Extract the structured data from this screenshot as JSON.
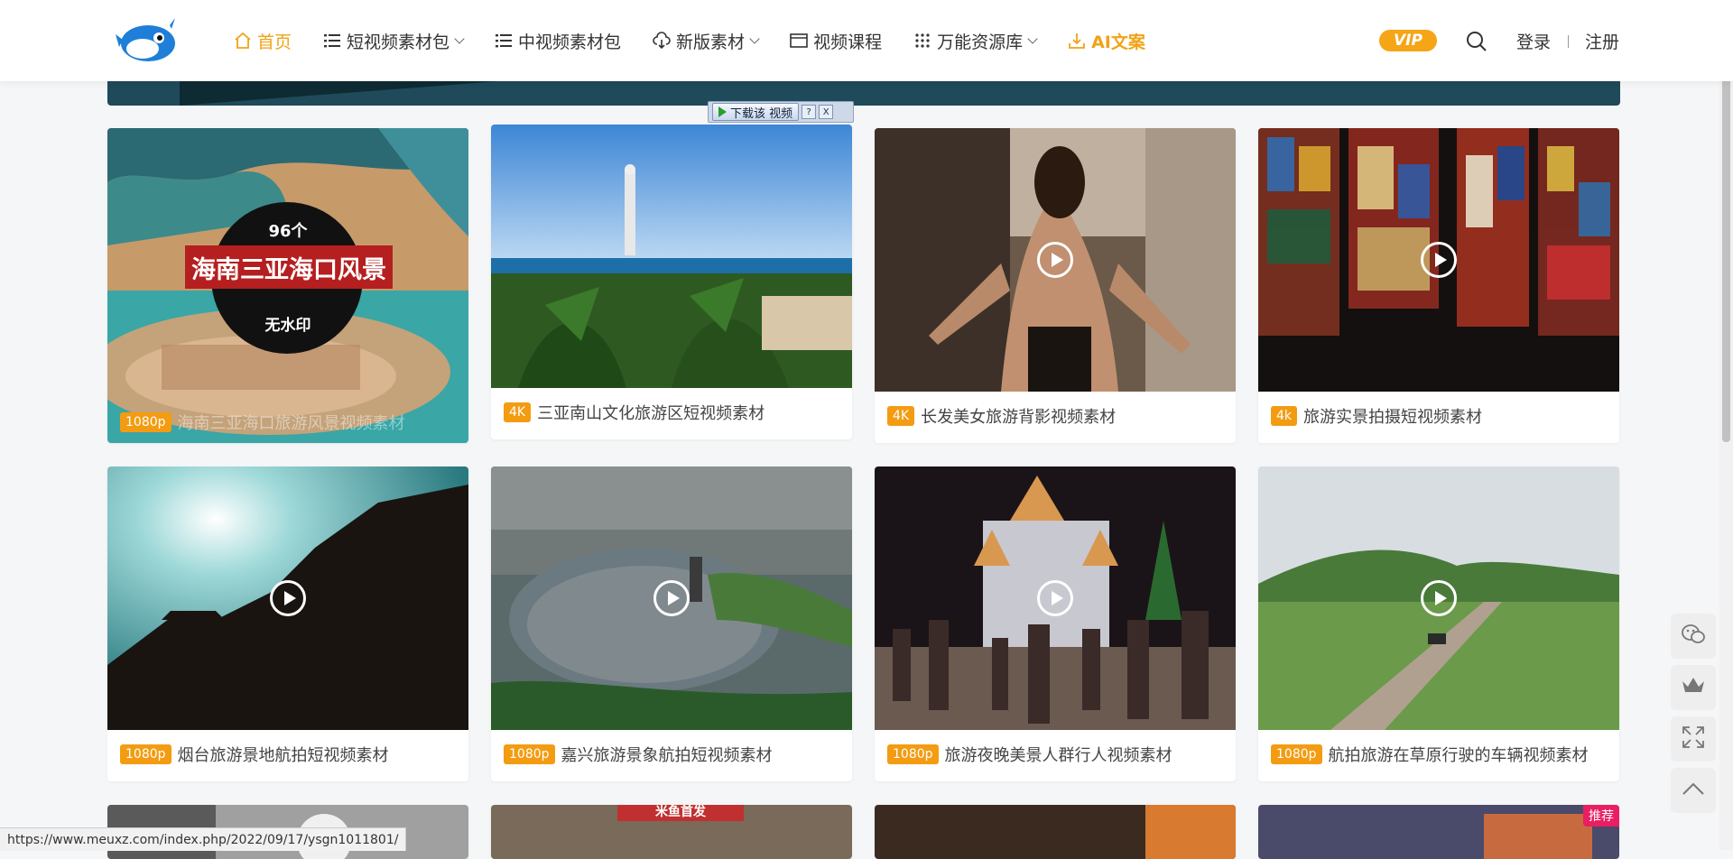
{
  "nav": {
    "items": [
      {
        "label": "首页",
        "icon": "home-icon",
        "active": true
      },
      {
        "label": "短视频素材包",
        "icon": "list-icon",
        "dropdown": true
      },
      {
        "label": "中视频素材包",
        "icon": "list-icon"
      },
      {
        "label": "新版素材",
        "icon": "cloud-download-icon",
        "dropdown": true
      },
      {
        "label": "视频课程",
        "icon": "window-icon"
      },
      {
        "label": "万能资源库",
        "icon": "grid-icon",
        "dropdown": true
      },
      {
        "label": "AI文案",
        "icon": "download-icon",
        "hot": true
      }
    ],
    "vip_label": "VIP",
    "login_label": "登录",
    "register_label": "注册"
  },
  "download_bar": {
    "label": "下载该 视频",
    "help": "?",
    "close": "X"
  },
  "cards": [
    {
      "badge": "1080p",
      "title": "海南三亚海口旅游风景视频素材",
      "overlay": {
        "count": "96个",
        "band": "海南三亚海口风景",
        "sub": "无水印"
      }
    },
    {
      "badge": "4K",
      "title": "三亚南山文化旅游区短视频素材"
    },
    {
      "badge": "4K",
      "title": "长发美女旅游背影视频素材"
    },
    {
      "badge": "4k",
      "title": "旅游实景拍摄短视频素材"
    },
    {
      "badge": "1080p",
      "title": "烟台旅游景地航拍短视频素材"
    },
    {
      "badge": "1080p",
      "title": "嘉兴旅游景象航拍短视频素材"
    },
    {
      "badge": "1080p",
      "title": "旅游夜晚美景人群行人视频素材"
    },
    {
      "badge": "1080p",
      "title": "航拍旅游在草原行驶的车辆视频素材"
    }
  ],
  "bottom_row": {
    "sign_text": "米鱼首发",
    "recommend_badge": "推荐"
  },
  "status_url": "https://www.meuxz.com/index.php/2022/09/17/ysgn1011801/",
  "colors": {
    "accent": "#f0a318",
    "badge": "#f39c12",
    "recommend": "#e91e63"
  }
}
